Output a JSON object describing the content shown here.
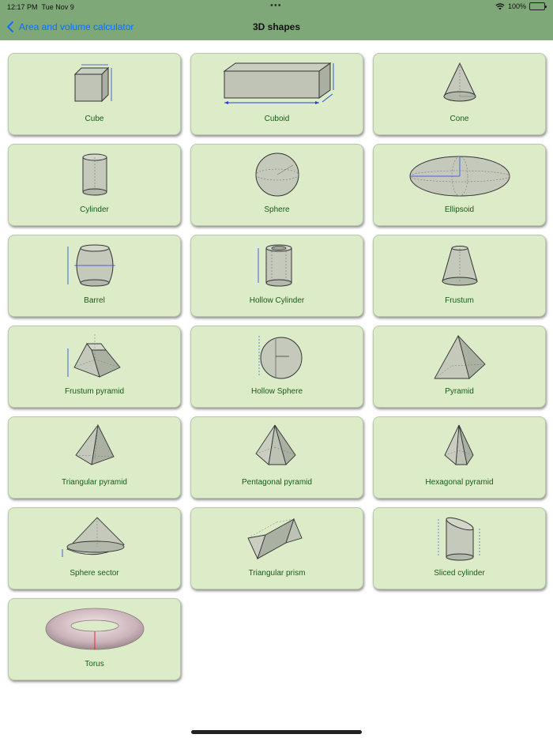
{
  "status": {
    "time": "12:17 PM",
    "date": "Tue Nov 9",
    "battery": "100%"
  },
  "nav": {
    "back_label": "Area and volume calculator",
    "title": "3D shapes"
  },
  "colors": {
    "nav_background": "#7fa878",
    "tile_background": "#dcecc8",
    "label_text": "#175a17",
    "link": "#0a6fff",
    "dimension_red": "#e02020",
    "dimension_blue": "#2040e0"
  },
  "shapes": [
    {
      "label": "Cube",
      "icon": "cube-icon"
    },
    {
      "label": "Cuboid",
      "icon": "cuboid-icon"
    },
    {
      "label": "Cone",
      "icon": "cone-icon"
    },
    {
      "label": "Cylinder",
      "icon": "cylinder-icon"
    },
    {
      "label": "Sphere",
      "icon": "sphere-icon"
    },
    {
      "label": "Ellipsoid",
      "icon": "ellipsoid-icon"
    },
    {
      "label": "Barrel",
      "icon": "barrel-icon"
    },
    {
      "label": "Hollow Cylinder",
      "icon": "hollow-cylinder-icon"
    },
    {
      "label": "Frustum",
      "icon": "frustum-icon"
    },
    {
      "label": "Frustum pyramid",
      "icon": "frustum-pyramid-icon"
    },
    {
      "label": "Hollow Sphere",
      "icon": "hollow-sphere-icon"
    },
    {
      "label": "Pyramid",
      "icon": "pyramid-icon"
    },
    {
      "label": "Triangular pyramid",
      "icon": "triangular-pyramid-icon"
    },
    {
      "label": "Pentagonal pyramid",
      "icon": "pentagonal-pyramid-icon"
    },
    {
      "label": "Hexagonal pyramid",
      "icon": "hexagonal-pyramid-icon"
    },
    {
      "label": "Sphere sector",
      "icon": "sphere-sector-icon"
    },
    {
      "label": "Triangular prism",
      "icon": "triangular-prism-icon"
    },
    {
      "label": "Sliced cylinder",
      "icon": "sliced-cylinder-icon"
    },
    {
      "label": "Torus",
      "icon": "torus-icon"
    }
  ]
}
